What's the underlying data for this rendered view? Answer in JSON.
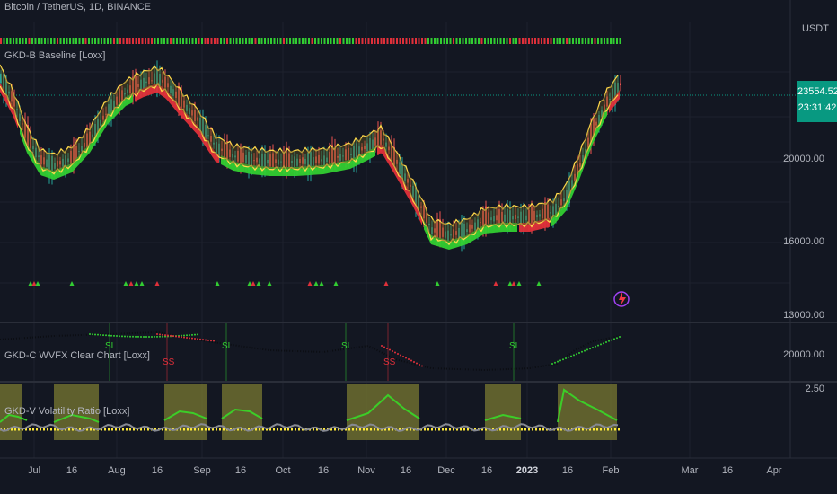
{
  "header": {
    "symbol_title": "Bitcoin / TetherUS, 1D, BINANCE",
    "currency": "USDT"
  },
  "indicators": {
    "baseline": "GKD-B Baseline [Loxx]",
    "wvfx": "GKD-C WVFX Clear Chart [Loxx]",
    "volatility": "GKD-V Volatility Ratio [Loxx]"
  },
  "price_axis": {
    "main": [
      "20000.00",
      "16000.00",
      "13000.00"
    ],
    "wvfx": "20000.00",
    "vol": "2.50"
  },
  "price_tag": {
    "price": "23554.52",
    "countdown": "23:31:42"
  },
  "time_axis": [
    {
      "label": "Jul",
      "bold": false
    },
    {
      "label": "16",
      "bold": false
    },
    {
      "label": "Aug",
      "bold": false
    },
    {
      "label": "16",
      "bold": false
    },
    {
      "label": "Sep",
      "bold": false
    },
    {
      "label": "16",
      "bold": false
    },
    {
      "label": "Oct",
      "bold": false
    },
    {
      "label": "16",
      "bold": false
    },
    {
      "label": "Nov",
      "bold": false
    },
    {
      "label": "16",
      "bold": false
    },
    {
      "label": "Dec",
      "bold": false
    },
    {
      "label": "16",
      "bold": false
    },
    {
      "label": "2023",
      "bold": true
    },
    {
      "label": "16",
      "bold": false
    },
    {
      "label": "Feb",
      "bold": false
    },
    {
      "label": "Mar",
      "bold": false
    },
    {
      "label": "16",
      "bold": false
    },
    {
      "label": "Apr",
      "bold": false
    }
  ],
  "signal_labels": {
    "long": "SL",
    "short": "SS"
  },
  "colors": {
    "up": "#26a69a",
    "down": "#ef5350",
    "band_up": "#32cd32",
    "band_down": "#e0303a",
    "baseline": "#ffd84a",
    "vol_box": "#7a7a32",
    "tag": "#089981"
  }
}
